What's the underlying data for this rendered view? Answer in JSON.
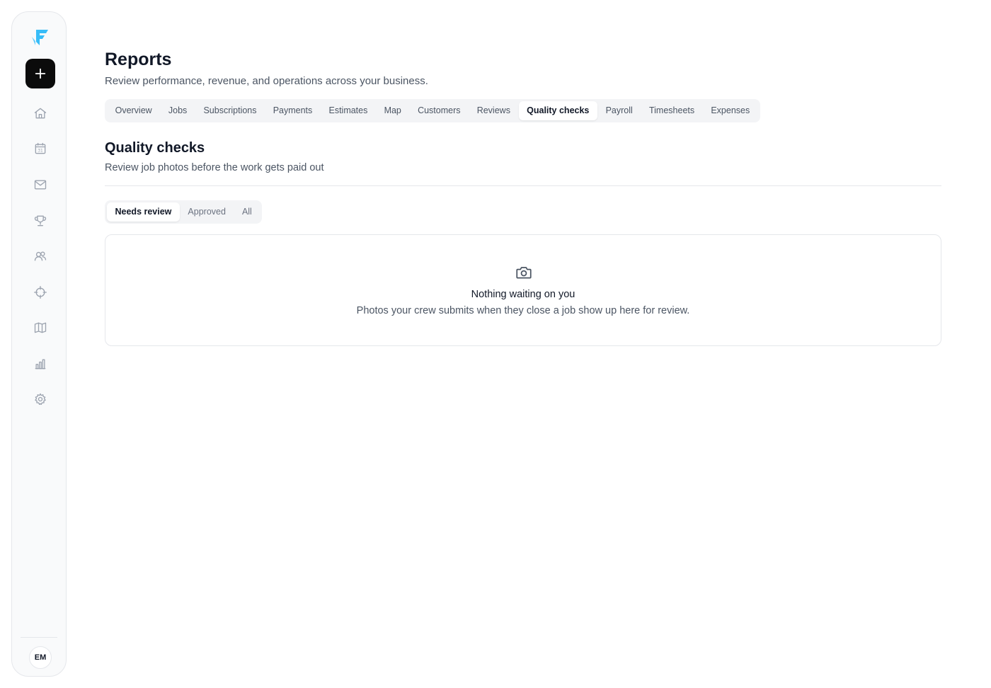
{
  "sidebar": {
    "icons": [
      "home-icon",
      "calendar-icon",
      "mail-icon",
      "trophy-icon",
      "users-icon",
      "crosshair-icon",
      "map-icon",
      "bar-chart-icon",
      "gear-icon"
    ],
    "calendar_day": "31",
    "avatar_initials": "EM"
  },
  "header": {
    "title": "Reports",
    "subtitle": "Review performance, revenue, and operations across your business."
  },
  "tabs": [
    {
      "label": "Overview"
    },
    {
      "label": "Jobs"
    },
    {
      "label": "Subscriptions"
    },
    {
      "label": "Payments"
    },
    {
      "label": "Estimates"
    },
    {
      "label": "Map"
    },
    {
      "label": "Customers"
    },
    {
      "label": "Reviews"
    },
    {
      "label": "Quality checks",
      "active": true
    },
    {
      "label": "Payroll"
    },
    {
      "label": "Timesheets"
    },
    {
      "label": "Expenses"
    }
  ],
  "section": {
    "title": "Quality checks",
    "subtitle": "Review job photos before the work gets paid out"
  },
  "filters": [
    {
      "label": "Needs review",
      "active": true
    },
    {
      "label": "Approved"
    },
    {
      "label": "All"
    }
  ],
  "empty_state": {
    "icon": "camera-icon",
    "title": "Nothing waiting on you",
    "text": "Photos your crew submits when they close a job show up here for review."
  },
  "colors": {
    "logo_accent": "#38bdf8",
    "primary_button": "#0b0b0b"
  }
}
